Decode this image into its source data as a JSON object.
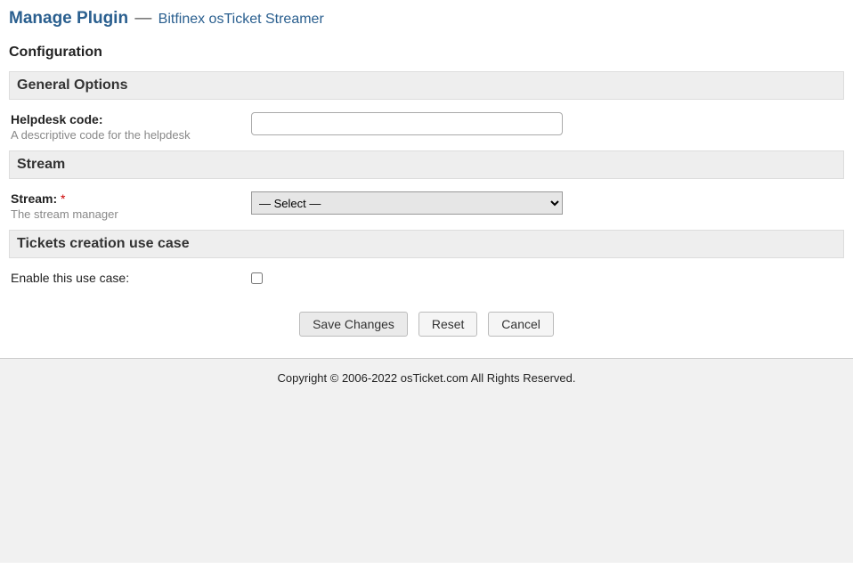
{
  "header": {
    "prefix": "Manage Plugin",
    "dash": "—",
    "plugin_name": "Bitfinex osTicket Streamer"
  },
  "subheading": "Configuration",
  "sections": {
    "general": {
      "title": "General Options",
      "helpdesk_code": {
        "label": "Helpdesk code:",
        "hint": "A descriptive code for the helpdesk",
        "value": ""
      }
    },
    "stream": {
      "title": "Stream",
      "stream_field": {
        "label": "Stream:",
        "required_marker": "*",
        "hint": "The stream manager",
        "selected": "— Select —"
      }
    },
    "tickets": {
      "title": "Tickets creation use case",
      "enable_field": {
        "label": "Enable this use case:",
        "checked": false
      }
    }
  },
  "buttons": {
    "save": "Save Changes",
    "reset": "Reset",
    "cancel": "Cancel"
  },
  "footer": {
    "copyright": "Copyright © 2006-2022 osTicket.com All Rights Reserved."
  }
}
